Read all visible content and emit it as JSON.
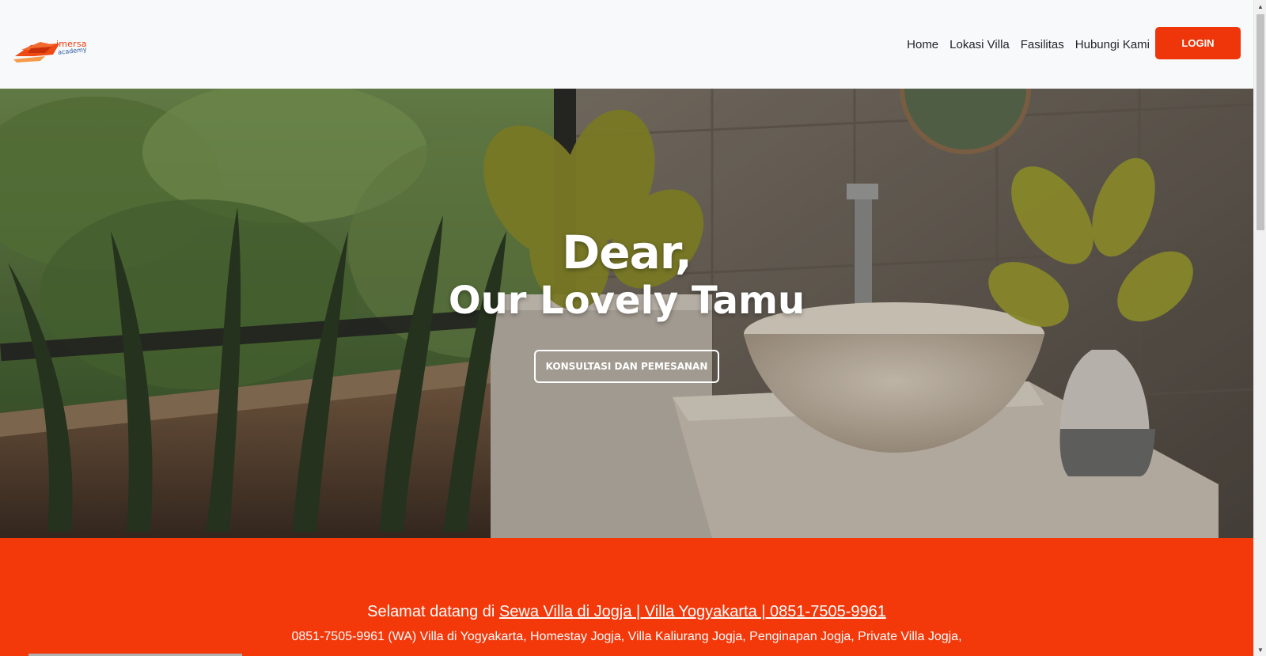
{
  "logo": {
    "brand_text": "imersa",
    "brand_sub": "academy"
  },
  "nav": {
    "links": [
      "Home",
      "Lokasi Villa",
      "Fasilitas",
      "Hubungi Kami"
    ],
    "login_label": "LOGIN"
  },
  "hero": {
    "line1": "Dear,",
    "line2": "Our Lovely Tamu",
    "cta_label": "KONSULTASI DAN PEMESANAN"
  },
  "welcome": {
    "prefix": "Selamat datang di",
    "link_text": "Sewa Villa di Jogja | Villa Yogyakarta | 0851-7505-9961",
    "description": "0851-7505-9961 (WA) Villa di Yogyakarta, Homestay Jogja, Villa Kaliurang Jogja, Penginapan Jogja, Private Villa Jogja,"
  },
  "colors": {
    "accent": "#f3380a",
    "navbar_bg": "#f8f9fa"
  }
}
